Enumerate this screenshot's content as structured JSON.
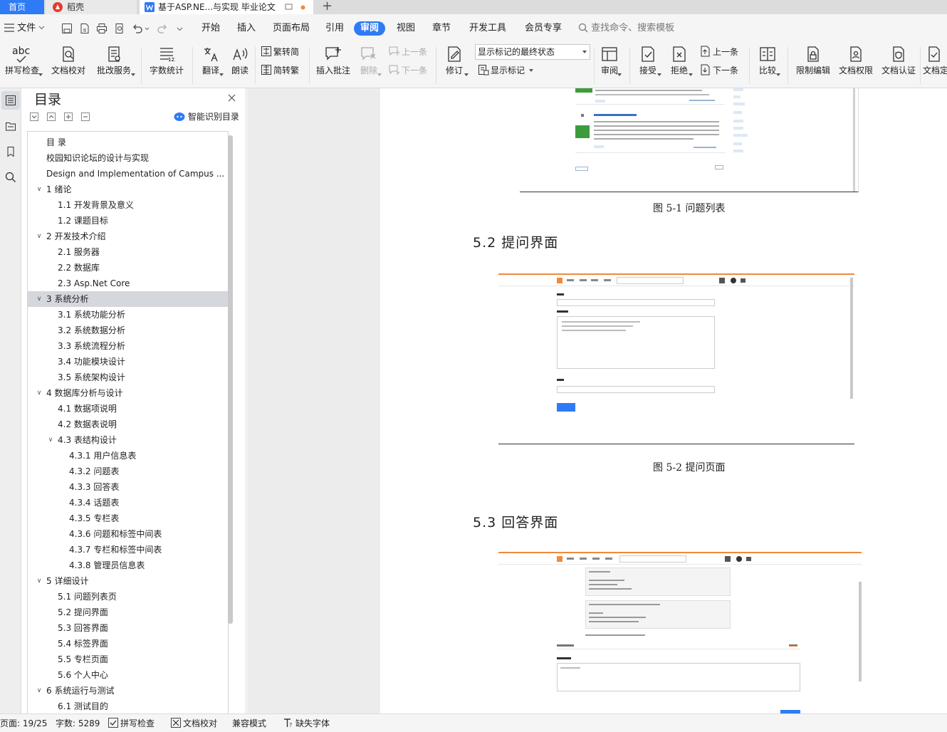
{
  "tabs": {
    "home": "首页",
    "docer": "稻壳",
    "doc": "基于ASP.NE...与实现 毕业论文",
    "new_tab": "+"
  },
  "menubar": {
    "file": "文件",
    "items": [
      "开始",
      "插入",
      "页面布局",
      "引用",
      "审阅",
      "视图",
      "章节",
      "开发工具",
      "会员专享"
    ],
    "active": "审阅",
    "search_placeholder": "查找命令、搜索模板"
  },
  "ribbon": {
    "spell_icon_text": "abc",
    "spell": "拼写检查",
    "proofread": "文档校对",
    "annotate_service": "批改服务",
    "word_count": "字数统计",
    "translate": "翻译",
    "read_aloud": "朗读",
    "trad_to_simp": "繁转简",
    "simp_to_trad": "简转繁",
    "insert_comment": "插入批注",
    "delete": "删除",
    "prev_comment": "上一条",
    "next_comment": "下一条",
    "track": "修订",
    "display_state": "显示标记的最终状态",
    "show_markup": "显示标记",
    "review": "审阅",
    "accept": "接受",
    "reject": "拒绝",
    "prev_change": "上一条",
    "next_change": "下一条",
    "compare": "比较",
    "restrict_edit": "限制编辑",
    "doc_permission": "文档权限",
    "doc_certify": "文档认证",
    "doc_final": "文档定"
  },
  "toc": {
    "title": "目录",
    "smart": "智能识别目录",
    "items": [
      {
        "text": "目 录",
        "level": 0
      },
      {
        "text": "校园知识论坛的设计与实现",
        "level": 0
      },
      {
        "text": "Design and Implementation of Campus ...",
        "level": 0
      },
      {
        "text": "1 绪论",
        "level": 1,
        "expanded": true
      },
      {
        "text": "1.1 开发背景及意义",
        "level": 2
      },
      {
        "text": "1.2 课题目标",
        "level": 2
      },
      {
        "text": "2 开发技术介绍",
        "level": 1,
        "expanded": true
      },
      {
        "text": "2.1 服务器",
        "level": 2
      },
      {
        "text": "2.2 数据库",
        "level": 2
      },
      {
        "text": "2.3 Asp.Net Core",
        "level": 2
      },
      {
        "text": "3 系统分析",
        "level": 1,
        "expanded": true,
        "selected": true
      },
      {
        "text": "3.1 系统功能分析",
        "level": 2
      },
      {
        "text": "3.2 系统数据分析",
        "level": 2
      },
      {
        "text": "3.3 系统流程分析",
        "level": 2
      },
      {
        "text": "3.4 功能模块设计",
        "level": 2
      },
      {
        "text": "3.5 系统架构设计",
        "level": 2
      },
      {
        "text": "4 数据库分析与设计",
        "level": 1,
        "expanded": true
      },
      {
        "text": "4.1 数据项说明",
        "level": 2
      },
      {
        "text": "4.2 数据表说明",
        "level": 2
      },
      {
        "text": "4.3 表结构设计",
        "level": 2,
        "expanded": true
      },
      {
        "text": "4.3.1 用户信息表",
        "level": 3
      },
      {
        "text": "4.3.2 问题表",
        "level": 3
      },
      {
        "text": "4.3.3 回答表",
        "level": 3
      },
      {
        "text": "4.3.4 话题表",
        "level": 3
      },
      {
        "text": "4.3.5 专栏表",
        "level": 3
      },
      {
        "text": "4.3.6 问题和标签中间表",
        "level": 3
      },
      {
        "text": "4.3.7 专栏和标签中间表",
        "level": 3
      },
      {
        "text": "4.3.8 管理员信息表",
        "level": 3
      },
      {
        "text": "5 详细设计",
        "level": 1,
        "expanded": true
      },
      {
        "text": "5.1 问题列表页",
        "level": 2
      },
      {
        "text": "5.2 提问界面",
        "level": 2
      },
      {
        "text": "5.3 回答界面",
        "level": 2
      },
      {
        "text": "5.4 标签界面",
        "level": 2
      },
      {
        "text": "5.5 专栏页面",
        "level": 2
      },
      {
        "text": "5.6 个人中心",
        "level": 2
      },
      {
        "text": "6 系统运行与测试",
        "level": 1,
        "expanded": true
      },
      {
        "text": "6.1 测试目的",
        "level": 2
      }
    ]
  },
  "document": {
    "fig1_caption": "图 5-1  问题列表",
    "heading_52": "5.2   提问界面",
    "fig2_caption": "图 5-2  提问页面",
    "heading_53": "5.3   回答界面"
  },
  "status": {
    "page": "页面: 19/25",
    "words": "字数: 5289",
    "spell": "拼写检查",
    "proofread": "文档校对",
    "compat": "兼容模式",
    "missing_font": "缺失字体"
  },
  "colors": {
    "accent": "#2f7bf5",
    "selection": "#d4d7dc",
    "orange_rule": "#f08a3c"
  }
}
